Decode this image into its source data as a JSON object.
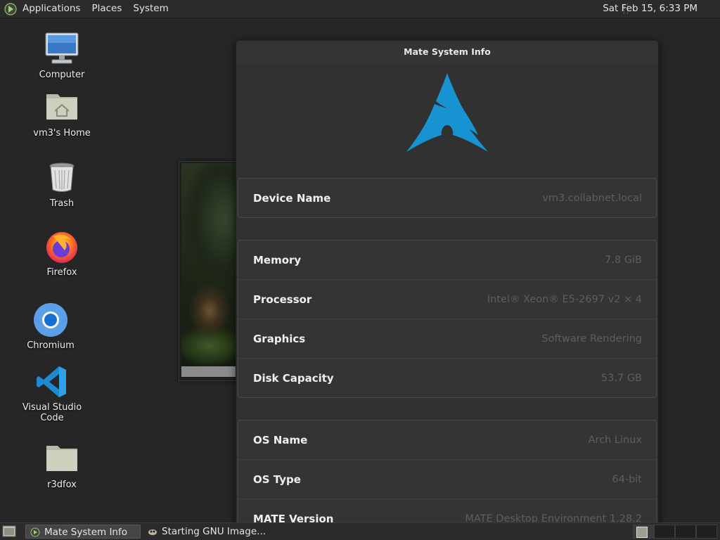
{
  "top_panel": {
    "menus": [
      "Applications",
      "Places",
      "System"
    ],
    "clock": "Sat Feb 15,  6:33 PM"
  },
  "desktop_icons": [
    {
      "label": "Computer",
      "icon": "computer-icon"
    },
    {
      "label": "vm3's Home",
      "icon": "home-folder-icon"
    },
    {
      "label": "Trash",
      "icon": "trash-icon"
    },
    {
      "label": "Firefox",
      "icon": "firefox-icon"
    },
    {
      "label": "Chromium",
      "icon": "chromium-icon"
    },
    {
      "label": "Visual Studio Code",
      "icon": "vscode-icon"
    },
    {
      "label": "r3dfox",
      "icon": "folder-icon"
    }
  ],
  "window": {
    "title": "Mate System Info",
    "device": {
      "label": "Device Name",
      "value": "vm3.collabnet.local"
    },
    "hardware": [
      {
        "label": "Memory",
        "value": "7.8 GiB"
      },
      {
        "label": "Processor",
        "value": "Intel® Xeon® E5-2697 v2 × 4"
      },
      {
        "label": "Graphics",
        "value": "Software Rendering"
      },
      {
        "label": "Disk Capacity",
        "value": "53.7 GB"
      }
    ],
    "software": [
      {
        "label": "OS Name",
        "value": "Arch Linux"
      },
      {
        "label": "OS Type",
        "value": "64-bit"
      },
      {
        "label": "MATE Version",
        "value": "MATE Desktop Environment 1.28.2"
      }
    ]
  },
  "taskbar": {
    "tasks": [
      {
        "label": "Mate System Info",
        "active": true
      },
      {
        "label": "Starting GNU Image...",
        "active": false
      }
    ]
  },
  "colors": {
    "arch_blue": "#1793d1",
    "value_text": "#5e5e5e",
    "window_bg": "#313131"
  }
}
